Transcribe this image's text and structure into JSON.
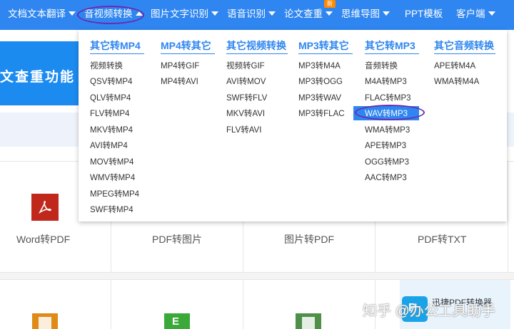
{
  "nav": {
    "items": [
      {
        "label": "文档文本翻译"
      },
      {
        "label": "音视频转换"
      },
      {
        "label": "图片文字识别"
      },
      {
        "label": "语音识别"
      },
      {
        "label": "论文查重"
      },
      {
        "label": "思维导图"
      },
      {
        "label": "PPT模板"
      },
      {
        "label": "客户端"
      }
    ],
    "new_badge": "新"
  },
  "banner": {
    "text": "文查重功能"
  },
  "cards": {
    "row1": [
      "Word转PDF",
      "PDF转图片",
      "图片转PDF",
      "PDF转TXT"
    ],
    "promo_text": "迅捷PDF转换器",
    "tile_letter": "E"
  },
  "watermark": "知乎 @办公工具助手",
  "menu": {
    "columns": [
      {
        "heading": "其它转MP4",
        "links": [
          "视频转换",
          "QSV转MP4",
          "QLV转MP4",
          "FLV转MP4",
          "MKV转MP4",
          "AVI转MP4",
          "MOV转MP4",
          "WMV转MP4",
          "MPEG转MP4",
          "SWF转MP4"
        ]
      },
      {
        "heading": "MP4转其它",
        "links": [
          "MP4转GIF",
          "MP4转AVI"
        ]
      },
      {
        "heading": "其它视频转换",
        "links": [
          "视频转GIF",
          "AVI转MOV",
          "SWF转FLV",
          "MKV转AVI",
          "FLV转AVI"
        ]
      },
      {
        "heading": "MP3转其它",
        "links": [
          "MP3转M4A",
          "MP3转OGG",
          "MP3转WAV",
          "MP3转FLAC"
        ]
      },
      {
        "heading": "其它转MP3",
        "links": [
          "音频转换",
          "M4A转MP3",
          "FLAC转MP3",
          "WAV转MP3",
          "WMA转MP3",
          "APE转MP3",
          "OGG转MP3",
          "AAC转MP3"
        ]
      },
      {
        "heading": "其它音频转换",
        "links": [
          "APE转M4A",
          "WMA转M4A"
        ]
      }
    ],
    "highlighted": "WAV转MP3"
  },
  "colors": {
    "nav_bg": "#2f86f0",
    "accent": "#2f86f0",
    "ring": "#6b2bb0",
    "badge": "#ff8a00"
  }
}
